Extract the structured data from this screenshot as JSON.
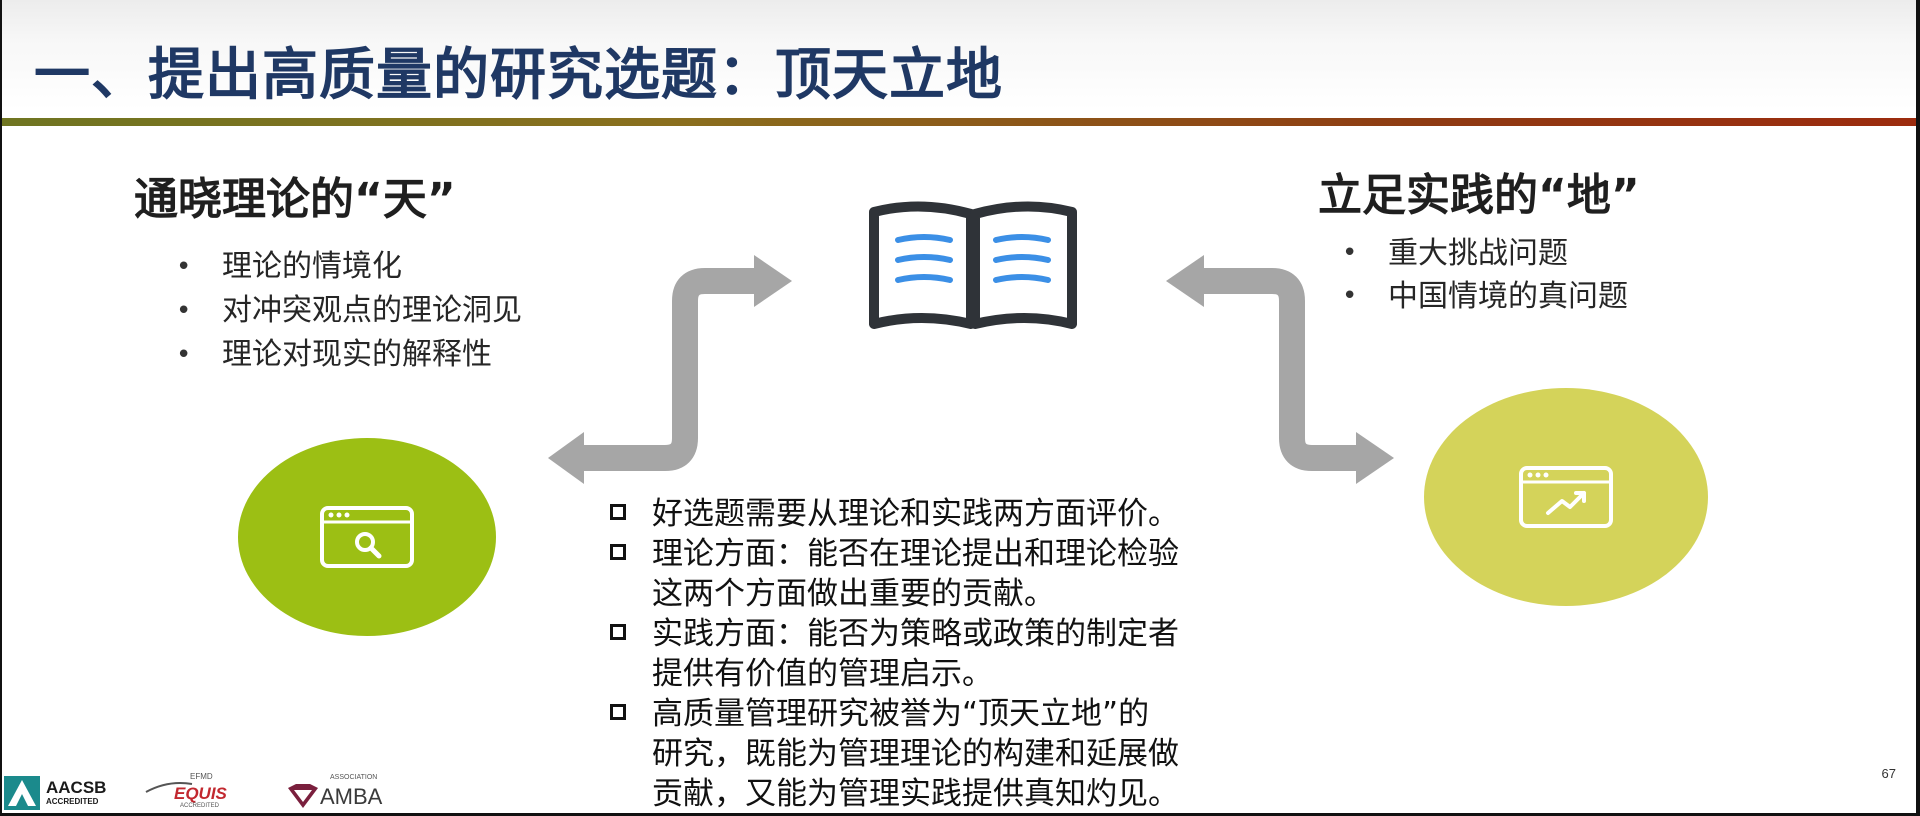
{
  "slide": {
    "title": "一、提出高质量的研究选题：顶天立地",
    "page_number": "67"
  },
  "theory": {
    "heading": "通晓理论的“天”",
    "items": [
      "理论的情境化",
      "对冲突观点的理论洞见",
      "理论对现实的解释性"
    ]
  },
  "practice": {
    "heading": "立足实践的“地”",
    "items": [
      "重大挑战问题",
      "中国情境的真问题"
    ]
  },
  "evaluation": {
    "items": [
      [
        "好选题需要从理论和实践两方面评价。"
      ],
      [
        "理论方面：能否在理论提出和理论检验",
        "这两个方面做出重要的贡献。"
      ],
      [
        "实践方面：能否为策略或政策的制定者",
        "提供有价值的管理启示。"
      ],
      [
        "高质量管理研究被誉为“顶天立地”的",
        "研究，既能为管理理论的构建和延展做",
        "贡献，又能为管理实践提供真知灼见。"
      ]
    ]
  },
  "logos": {
    "aacsb": "AACSB",
    "aacsb_sub": "ACCREDITED",
    "efmd": "EFMD",
    "equis": "EQUIS",
    "equis_sub": "ACCREDITED",
    "association": "ASSOCIATION",
    "amba": "AMBA"
  },
  "icons": {
    "book": "open-book-icon",
    "theory_circle": "search-window-icon",
    "practice_circle": "chart-window-icon"
  },
  "colors": {
    "title": "#1f3864",
    "theory_circle": "#9cbf14",
    "practice_circle": "#d4d35a",
    "book_lines": "#3b8fe6",
    "arrows": "#a6a6a6"
  }
}
